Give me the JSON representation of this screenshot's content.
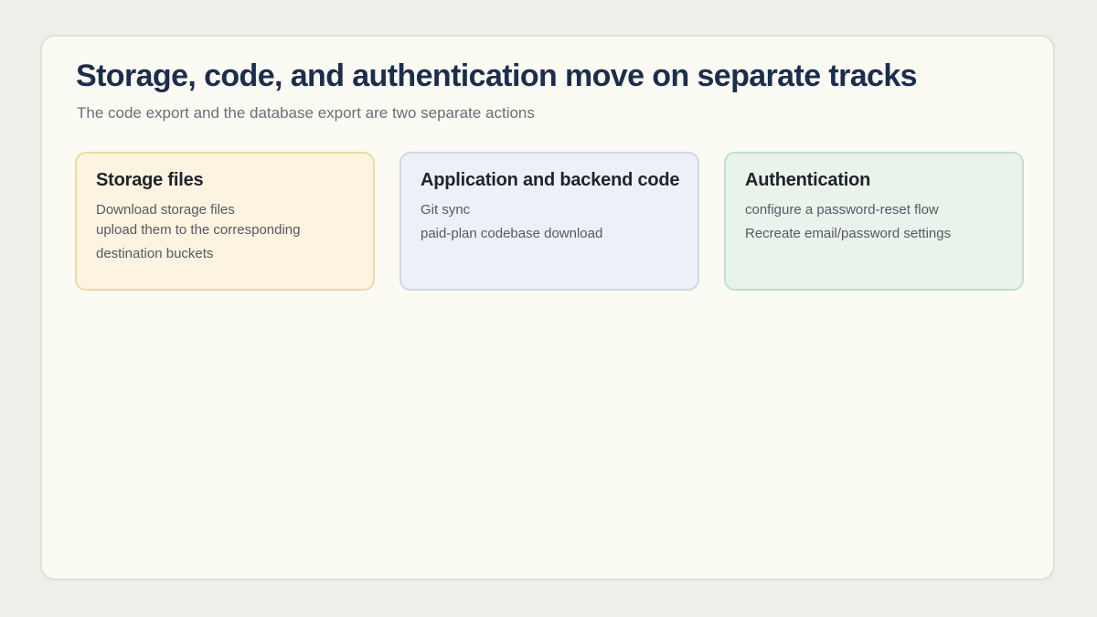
{
  "title": "Storage, code, and authentication move on separate tracks",
  "subtitle": "The code export and the database export are two separate actions",
  "cards": [
    {
      "title": "Storage files",
      "lines": [
        "Download storage files",
        "upload them to the corresponding",
        "destination buckets"
      ]
    },
    {
      "title": "Application and backend code",
      "lines": [
        "Git sync",
        "paid-plan codebase download"
      ]
    },
    {
      "title": "Authentication",
      "lines": [
        "configure a password-reset flow",
        "Recreate email/password settings"
      ]
    }
  ],
  "colors": {
    "page_background": "#f0eee9",
    "panel_background": "#fbfaf3",
    "title": "#1c2d4d",
    "storage_card": "#fcf3e0",
    "code_card": "#edf0f8",
    "auth_card": "#e9f3ec"
  }
}
